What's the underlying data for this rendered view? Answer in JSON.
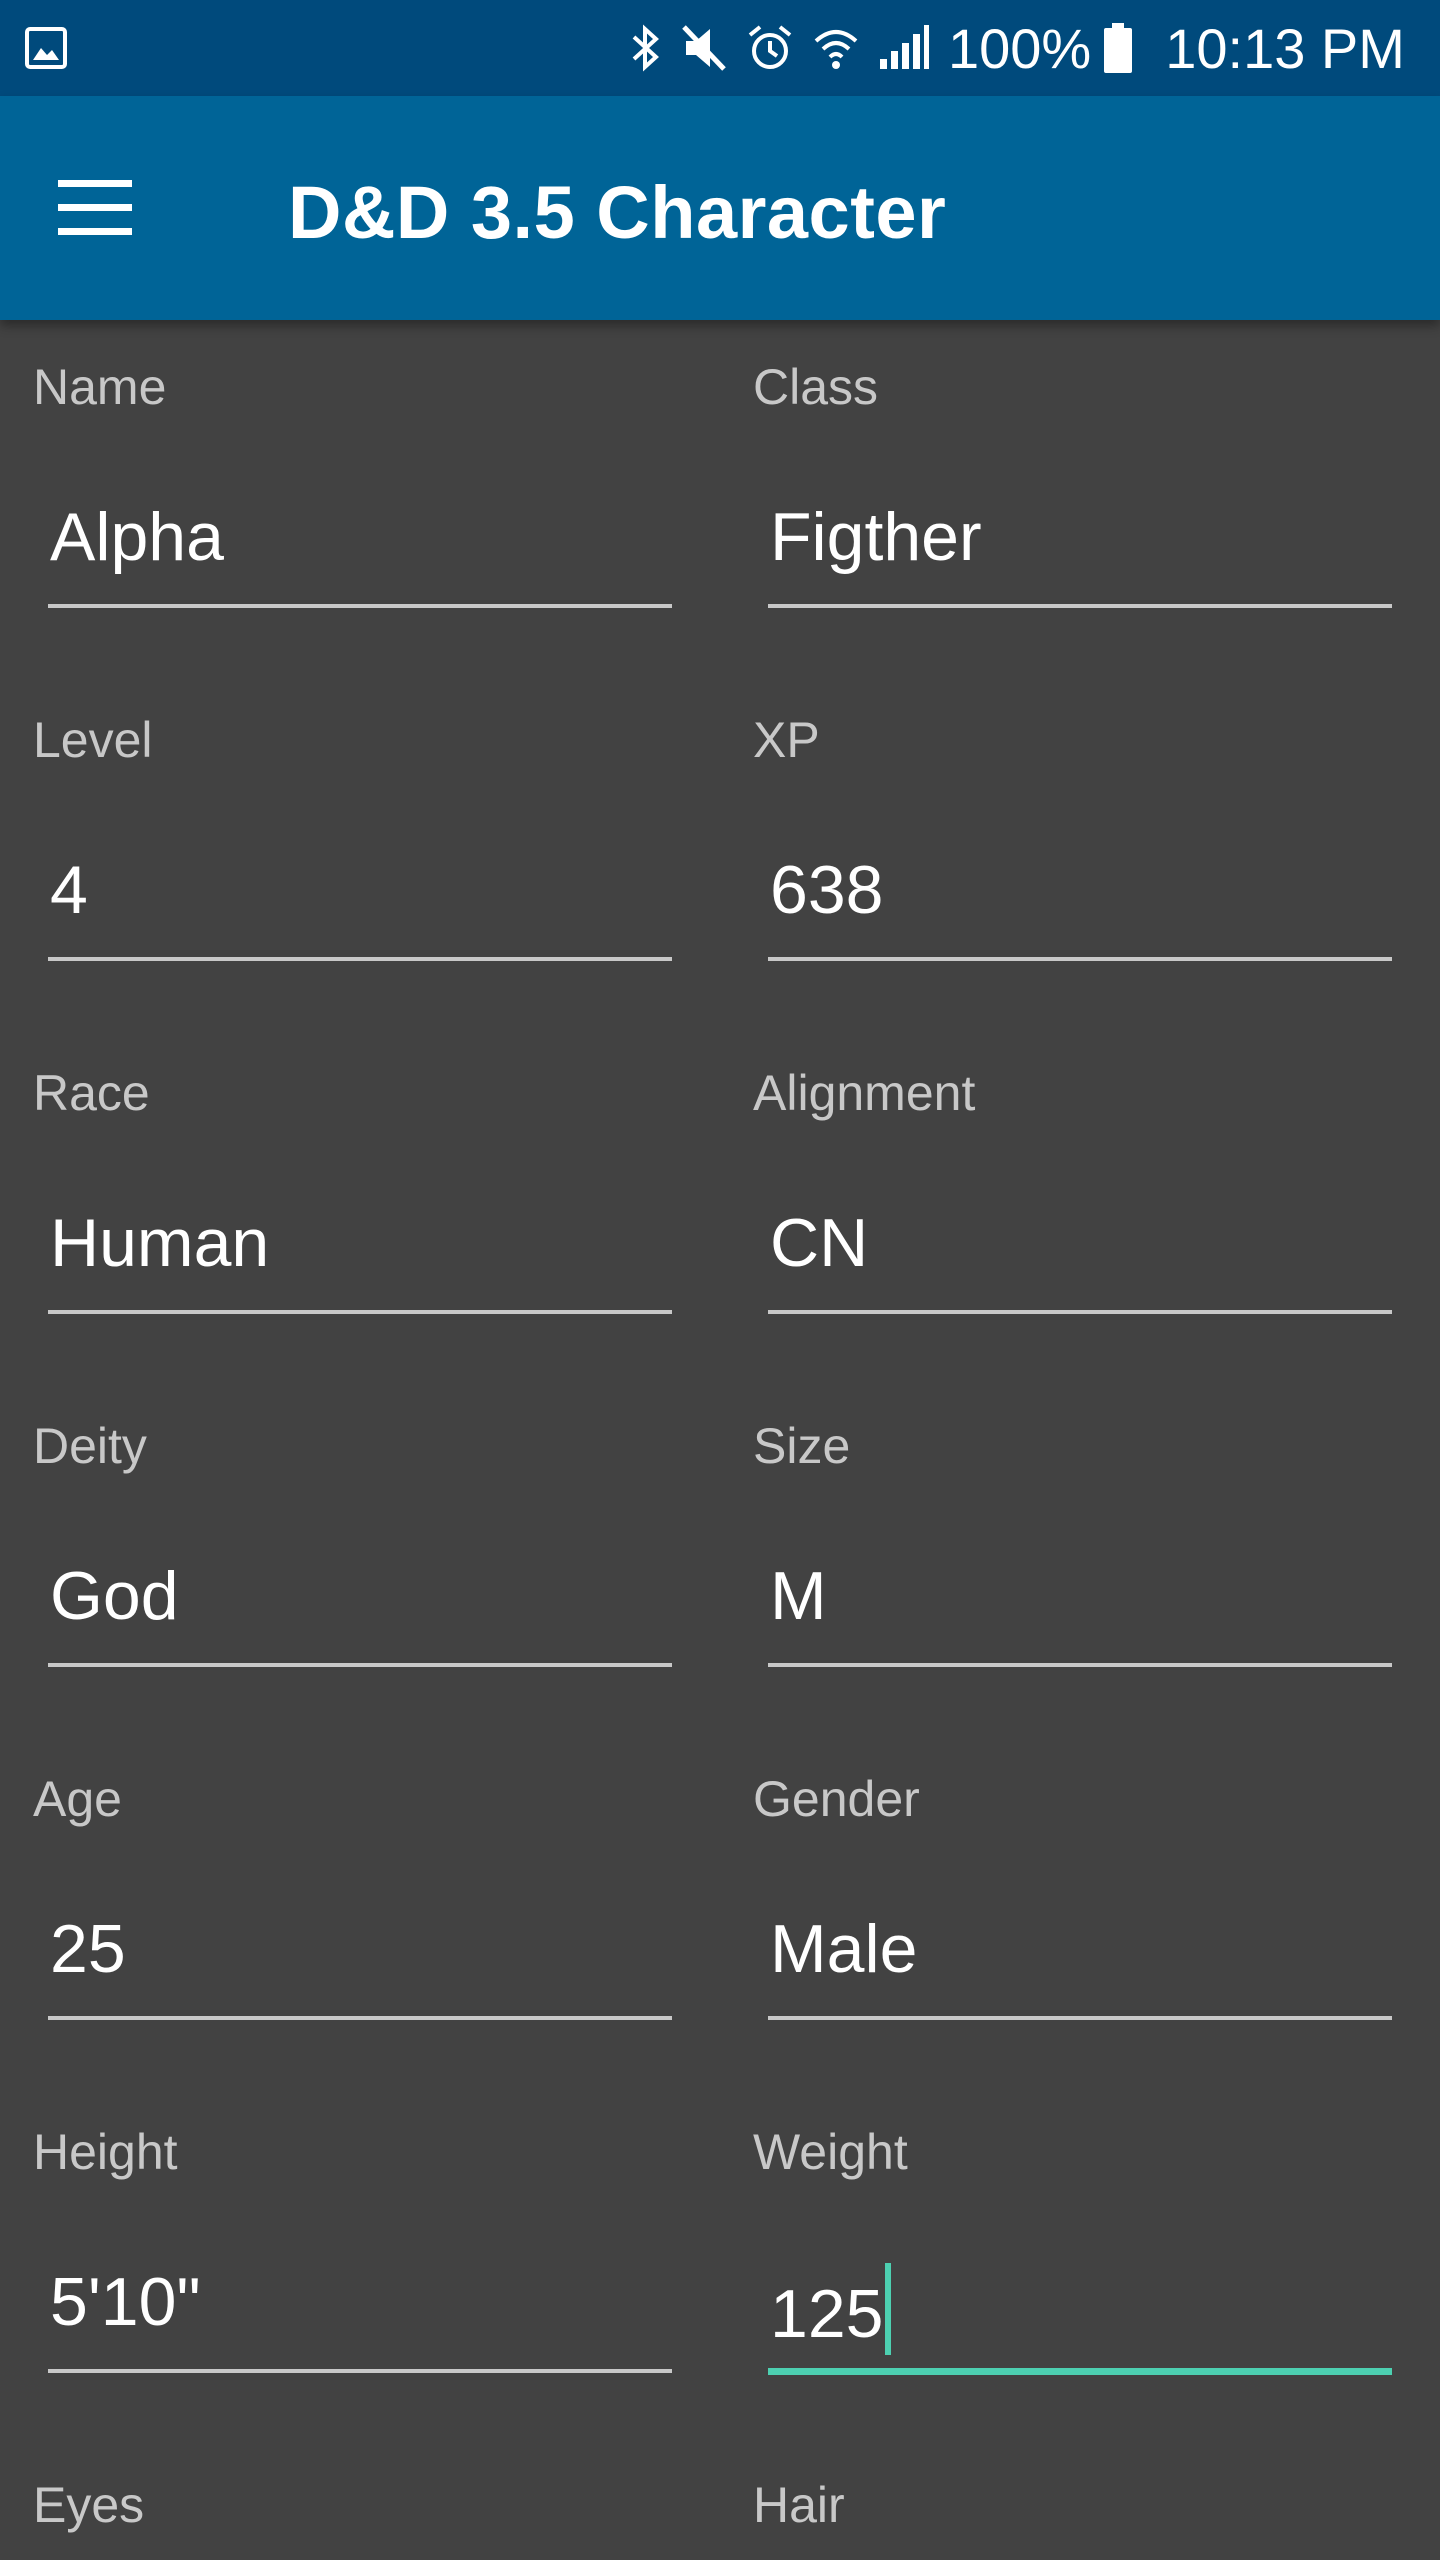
{
  "status_bar": {
    "battery": "100%",
    "time": "10:13 PM"
  },
  "app_bar": {
    "title": "D&D 3.5 Character"
  },
  "fields": {
    "name": {
      "label": "Name",
      "value": "Alpha"
    },
    "class": {
      "label": "Class",
      "value": "Figther"
    },
    "level": {
      "label": "Level",
      "value": "4"
    },
    "xp": {
      "label": "XP",
      "value": "638"
    },
    "race": {
      "label": "Race",
      "value": "Human"
    },
    "alignment": {
      "label": "Alignment",
      "value": "CN"
    },
    "deity": {
      "label": "Deity",
      "value": "God"
    },
    "size": {
      "label": "Size",
      "value": "M"
    },
    "age": {
      "label": "Age",
      "value": "25"
    },
    "gender": {
      "label": "Gender",
      "value": "Male"
    },
    "height": {
      "label": "Height",
      "value": "5'10\""
    },
    "weight": {
      "label": "Weight",
      "value": "125"
    },
    "eyes": {
      "label": "Eyes",
      "value": ""
    },
    "hair": {
      "label": "Hair",
      "value": ""
    }
  },
  "colors": {
    "status_bar": "#004a7c",
    "app_bar": "#006497",
    "background": "#424242",
    "accent": "#4dd0b1",
    "label": "#c8c8c8",
    "text": "#ffffff"
  }
}
